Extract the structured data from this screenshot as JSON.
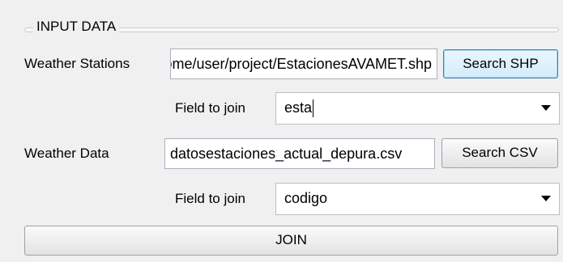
{
  "group": {
    "title": "INPUT DATA"
  },
  "stations": {
    "label": "Weather Stations",
    "path": "/home/user/project/EstacionesAVAMET.shp",
    "button": "Search SHP",
    "field_label": "Field to join",
    "field_value": "esta"
  },
  "data": {
    "label": "Weather Data",
    "path": "datosestaciones_actual_depura.csv",
    "button": "Search CSV",
    "field_label": "Field to join",
    "field_value": "codigo"
  },
  "join": {
    "label": "JOIN"
  },
  "icons": {
    "dropdown": "chevron-down-icon"
  }
}
